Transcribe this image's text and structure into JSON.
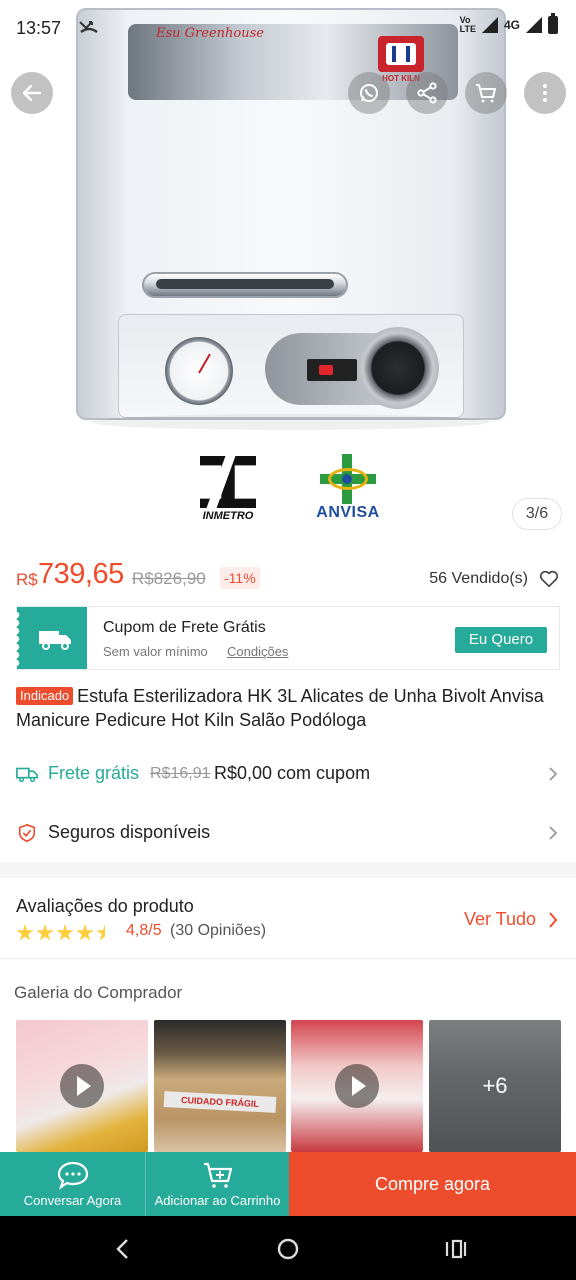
{
  "status_bar": {
    "time": "13:57",
    "missed_call_icon": "missed-call-icon",
    "network_labels": [
      "Vo",
      "LTE",
      "4G"
    ]
  },
  "top_actions": {
    "back_icon": "arrow-left-icon",
    "whatsapp_icon": "whatsapp-icon",
    "share_icon": "share-icon",
    "cart_icon": "shopping-cart-icon",
    "more_icon": "more-vertical-icon"
  },
  "product_image": {
    "brand_script": "Esu Greenhouse",
    "brand_logo_text": "HOT KILN",
    "certifications": [
      "INMETRO",
      "ANVISA"
    ],
    "image_counter": "3/6"
  },
  "price": {
    "currency": "R$",
    "current": "739,65",
    "original": "R$826,90",
    "discount": "-11%",
    "sold": "56 Vendido(s)"
  },
  "coupon": {
    "title": "Cupom de Frete Grátis",
    "subtitle": "Sem valor mínimo",
    "conditions_link": "Condições",
    "button": "Eu Quero",
    "color": "#26aa99"
  },
  "product": {
    "tag": "Indicado",
    "title": "Estufa Esterilizadora HK 3L Alicates de Unha Bivolt Anvisa Manicure Pedicure Hot Kiln Salão Podóloga"
  },
  "shipping": {
    "label": "Frete grátis",
    "old_price": "R$16,91",
    "new_price": "R$0,00 com cupom"
  },
  "insurance": {
    "label": "Seguros disponíveis"
  },
  "reviews": {
    "title": "Avaliações do produto",
    "rating": "4,8/5",
    "count": "(30 Opiniões)",
    "stars": 4.8,
    "see_all": "Ver Tudo"
  },
  "gallery": {
    "title": "Galeria do Comprador",
    "thumb2_text": "CUIDADO FRÁGIL",
    "more_count": "+6"
  },
  "action_bar": {
    "chat_label": "Conversar Agora",
    "add_cart_label": "Adicionar ao Carrinho",
    "buy_label": "Compre agora",
    "accent": "#ee4d2d",
    "secondary": "#26aa99"
  },
  "system_nav": {
    "back": "nav-back-icon",
    "home": "nav-home-icon",
    "recents": "nav-recents-icon"
  }
}
